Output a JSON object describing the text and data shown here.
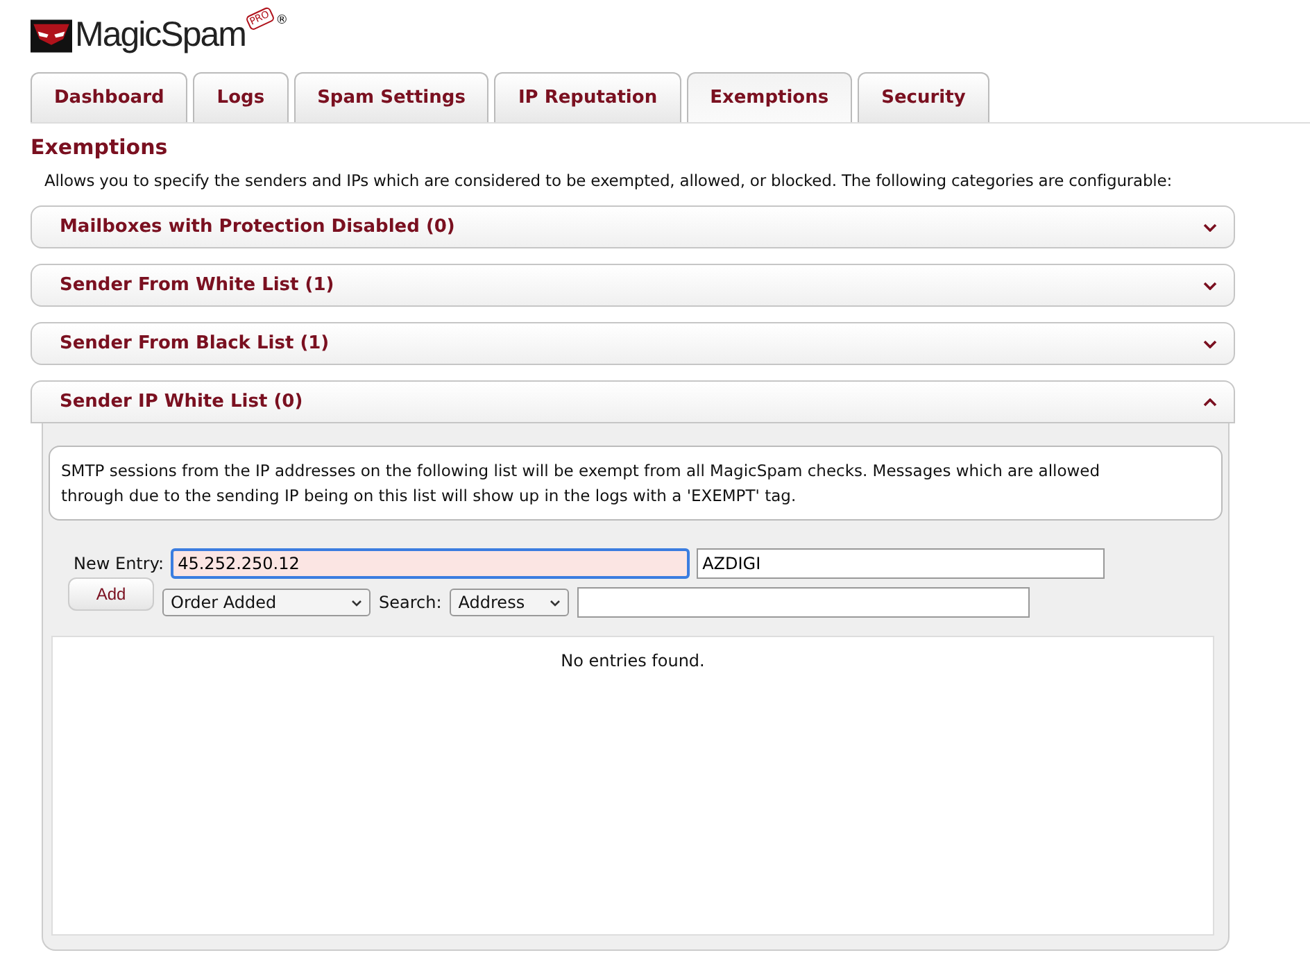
{
  "logo": {
    "name": "MagicSpam",
    "badge": "PRO",
    "mark": "®"
  },
  "tabs": [
    {
      "label": "Dashboard",
      "selected": false
    },
    {
      "label": "Logs",
      "selected": false
    },
    {
      "label": "Spam Settings",
      "selected": false
    },
    {
      "label": "IP Reputation",
      "selected": false
    },
    {
      "label": "Exemptions",
      "selected": true
    },
    {
      "label": "Security",
      "selected": false
    }
  ],
  "page_title": "Exemptions",
  "intro": "Allows you to specify the senders and IPs which are considered to be exempted, allowed, or blocked. The following categories are configurable:",
  "sections": [
    {
      "title": "Mailboxes with Protection Disabled (0)",
      "expanded": false
    },
    {
      "title": "Sender From White List (1)",
      "expanded": false
    },
    {
      "title": "Sender From Black List (1)",
      "expanded": false
    },
    {
      "title": "Sender IP White List (0)",
      "expanded": true
    }
  ],
  "panel": {
    "description": "SMTP sessions from the IP addresses on the following list will be exempt from all MagicSpam checks. Messages which are allowed through due to the sending IP being on this list will show up in the logs with a 'EXEMPT' tag.",
    "new_entry_label": "New Entry:",
    "entry_value": "45.252.250.12",
    "comment_value": "AZDIGI",
    "add_button": "Add",
    "sort_value": "Order Added",
    "search_label": "Search:",
    "search_field_value": "Address",
    "empty_message": "No entries found."
  }
}
